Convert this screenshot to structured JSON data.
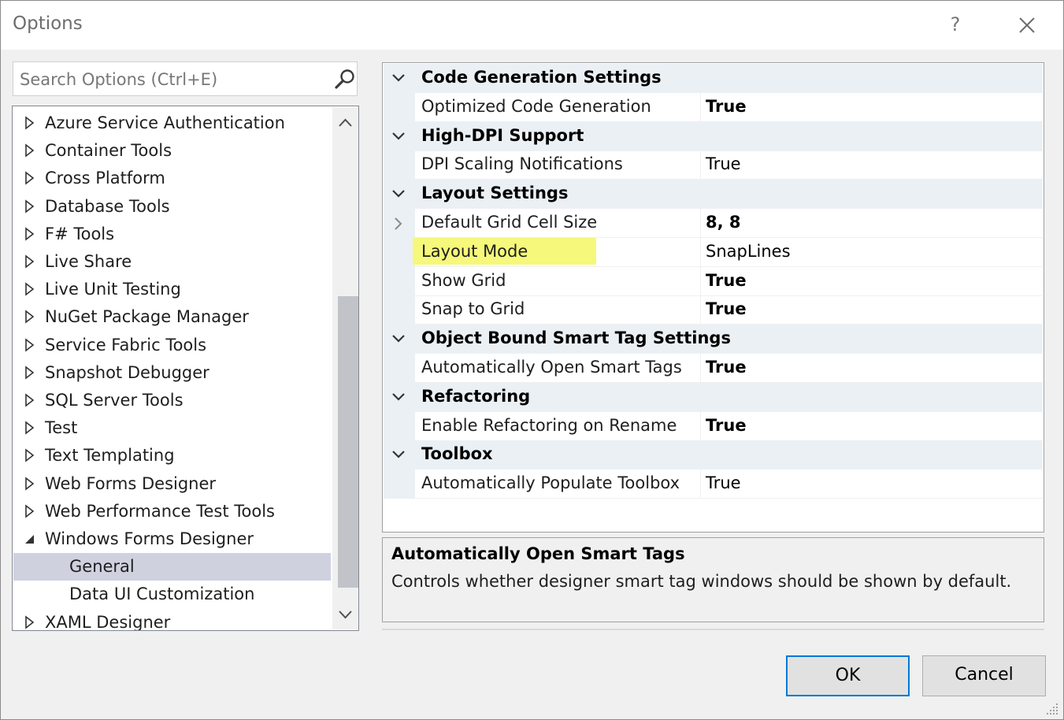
{
  "window": {
    "title": "Options",
    "help_label": "?"
  },
  "search": {
    "placeholder": "Search Options (Ctrl+E)"
  },
  "tree": {
    "items": [
      {
        "label": "Azure Service Authentication",
        "state": "collapsed",
        "level": 0
      },
      {
        "label": "Container Tools",
        "state": "collapsed",
        "level": 0
      },
      {
        "label": "Cross Platform",
        "state": "collapsed",
        "level": 0
      },
      {
        "label": "Database Tools",
        "state": "collapsed",
        "level": 0
      },
      {
        "label": "F# Tools",
        "state": "collapsed",
        "level": 0
      },
      {
        "label": "Live Share",
        "state": "collapsed",
        "level": 0
      },
      {
        "label": "Live Unit Testing",
        "state": "collapsed",
        "level": 0
      },
      {
        "label": "NuGet Package Manager",
        "state": "collapsed",
        "level": 0
      },
      {
        "label": "Service Fabric Tools",
        "state": "collapsed",
        "level": 0
      },
      {
        "label": "Snapshot Debugger",
        "state": "collapsed",
        "level": 0
      },
      {
        "label": "SQL Server Tools",
        "state": "collapsed",
        "level": 0
      },
      {
        "label": "Test",
        "state": "collapsed",
        "level": 0
      },
      {
        "label": "Text Templating",
        "state": "collapsed",
        "level": 0
      },
      {
        "label": "Web Forms Designer",
        "state": "collapsed",
        "level": 0
      },
      {
        "label": "Web Performance Test Tools",
        "state": "collapsed",
        "level": 0
      },
      {
        "label": "Windows Forms Designer",
        "state": "expanded",
        "level": 0
      },
      {
        "label": "General",
        "state": "leaf",
        "level": 1,
        "selected": true
      },
      {
        "label": "Data UI Customization",
        "state": "leaf",
        "level": 1
      },
      {
        "label": "XAML Designer",
        "state": "collapsed",
        "level": 0
      }
    ]
  },
  "property_grid": {
    "rows": [
      {
        "kind": "category",
        "label": "Code Generation Settings"
      },
      {
        "kind": "property",
        "name": "Optimized Code Generation",
        "value": "True",
        "bold": true
      },
      {
        "kind": "category",
        "label": "High-DPI Support"
      },
      {
        "kind": "property",
        "name": "DPI Scaling Notifications",
        "value": "True",
        "bold": false
      },
      {
        "kind": "category",
        "label": "Layout Settings"
      },
      {
        "kind": "property",
        "name": "Default Grid Cell Size",
        "value": "8, 8",
        "bold": true,
        "expandable": true
      },
      {
        "kind": "property",
        "name": "Layout Mode",
        "value": "SnapLines",
        "bold": false,
        "highlighted": true
      },
      {
        "kind": "property",
        "name": "Show Grid",
        "value": "True",
        "bold": true
      },
      {
        "kind": "property",
        "name": "Snap to Grid",
        "value": "True",
        "bold": true
      },
      {
        "kind": "category",
        "label": "Object Bound Smart Tag Settings"
      },
      {
        "kind": "property",
        "name": "Automatically Open Smart Tags",
        "value": "True",
        "bold": true
      },
      {
        "kind": "category",
        "label": "Refactoring"
      },
      {
        "kind": "property",
        "name": "Enable Refactoring on Rename",
        "value": "True",
        "bold": true
      },
      {
        "kind": "category",
        "label": "Toolbox"
      },
      {
        "kind": "property",
        "name": "Automatically Populate Toolbox",
        "value": "True",
        "bold": false
      }
    ]
  },
  "description": {
    "title": "Automatically Open Smart Tags",
    "text": "Controls whether designer smart tag windows should be shown by default."
  },
  "buttons": {
    "ok_label": "OK",
    "cancel_label": "Cancel"
  },
  "colors": {
    "highlight": "#f5f87a",
    "selected_row": "#cfd1df",
    "focus_border": "#0078d7",
    "category_bg": "#ebf0f5"
  }
}
